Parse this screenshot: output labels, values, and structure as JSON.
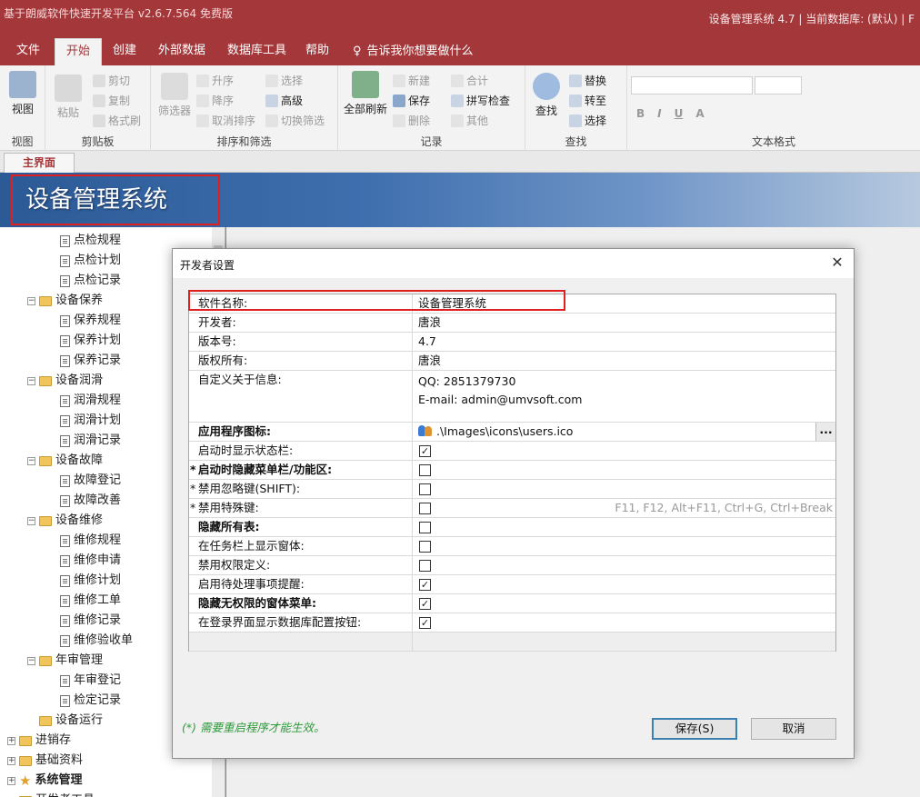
{
  "titlebar": {
    "app_caption": "基于朗威软件快速开发平台 v2.6.7.564 免费版",
    "window_info": "设备管理系统 4.7 | 当前数据库: (默认) | F"
  },
  "menu": {
    "tabs": [
      "文件",
      "开始",
      "创建",
      "外部数据",
      "数据库工具",
      "帮助"
    ],
    "active": "开始",
    "tell_me": "告诉我你想要做什么"
  },
  "ribbon": {
    "view": {
      "button": "视图",
      "label": "视图"
    },
    "clipboard": {
      "paste": "粘贴",
      "cut": "剪切",
      "copy": "复制",
      "format_painter": "格式刷",
      "label": "剪贴板"
    },
    "sort_filter": {
      "filter": "筛选器",
      "asc": "升序",
      "desc": "降序",
      "remove_sort": "取消排序",
      "select": "选择",
      "advanced": "高级",
      "toggle": "切换筛选",
      "label": "排序和筛选"
    },
    "records": {
      "refresh_all": "全部刷新",
      "new": "新建",
      "save": "保存",
      "delete": "删除",
      "totals": "合计",
      "spelling": "拼写检查",
      "more": "其他",
      "label": "记录"
    },
    "find": {
      "find": "查找",
      "replace": "替换",
      "goto": "转至",
      "select": "选择",
      "label": "查找"
    },
    "text_format": {
      "label": "文本格式",
      "bold": "B",
      "italic": "I",
      "underline": "U",
      "font_color": "A"
    }
  },
  "doc_tab": "主界面",
  "banner_title": "设备管理系统",
  "tree": [
    {
      "label": "点检规程",
      "type": "doc",
      "level": 2
    },
    {
      "label": "点检计划",
      "type": "doc",
      "level": 2
    },
    {
      "label": "点检记录",
      "type": "doc",
      "level": 2
    },
    {
      "label": "设备保养",
      "type": "folder",
      "level": 1
    },
    {
      "label": "保养规程",
      "type": "doc",
      "level": 2
    },
    {
      "label": "保养计划",
      "type": "doc",
      "level": 2
    },
    {
      "label": "保养记录",
      "type": "doc",
      "level": 2
    },
    {
      "label": "设备润滑",
      "type": "folder",
      "level": 1
    },
    {
      "label": "润滑规程",
      "type": "doc",
      "level": 2
    },
    {
      "label": "润滑计划",
      "type": "doc",
      "level": 2
    },
    {
      "label": "润滑记录",
      "type": "doc",
      "level": 2
    },
    {
      "label": "设备故障",
      "type": "folder",
      "level": 1
    },
    {
      "label": "故障登记",
      "type": "doc",
      "level": 2
    },
    {
      "label": "故障改善",
      "type": "doc",
      "level": 2
    },
    {
      "label": "设备维修",
      "type": "folder",
      "level": 1
    },
    {
      "label": "维修规程",
      "type": "doc",
      "level": 2
    },
    {
      "label": "维修申请",
      "type": "doc",
      "level": 2
    },
    {
      "label": "维修计划",
      "type": "doc",
      "level": 2
    },
    {
      "label": "维修工单",
      "type": "doc",
      "level": 2
    },
    {
      "label": "维修记录",
      "type": "doc",
      "level": 2
    },
    {
      "label": "维修验收单",
      "type": "doc",
      "level": 2
    },
    {
      "label": "年审管理",
      "type": "folder",
      "level": 1
    },
    {
      "label": "年审登记",
      "type": "doc",
      "level": 2
    },
    {
      "label": "检定记录",
      "type": "doc",
      "level": 2
    },
    {
      "label": "设备运行",
      "type": "folder",
      "level": 1
    },
    {
      "label": "进销存",
      "type": "root",
      "level": 0
    },
    {
      "label": "基础资料",
      "type": "root",
      "level": 0
    },
    {
      "label": "系统管理",
      "type": "root-star",
      "level": 0
    },
    {
      "label": "开发者工具",
      "type": "root",
      "level": 0
    }
  ],
  "dialog": {
    "title": "开发者设置",
    "close": "✕",
    "rows": [
      {
        "key": "软件名称:",
        "value": "设备管理系统",
        "bold": false
      },
      {
        "key": "开发者:",
        "value": "唐浪",
        "bold": false
      },
      {
        "key": "版本号:",
        "value": "4.7",
        "bold": false
      },
      {
        "key": "版权所有:",
        "value": "唐浪",
        "bold": false
      },
      {
        "key": "自定义关于信息:",
        "value_lines": [
          "QQ:  2851379730",
          "E-mail:  admin@umvsoft.com"
        ],
        "bold": false
      },
      {
        "key": "应用程序图标:",
        "value": ".\\Images\\icons\\users.ico",
        "bold": true,
        "browse": "..."
      },
      {
        "key": "启动时显示状态栏:",
        "checked": true,
        "bold": false
      },
      {
        "key": "启动时隐藏菜单栏/功能区:",
        "checked": false,
        "bold": true,
        "mark": "*"
      },
      {
        "key": "禁用忽略键(SHIFT):",
        "checked": false,
        "bold": false,
        "mark": "*"
      },
      {
        "key": "禁用特殊键:",
        "checked": false,
        "bold": false,
        "mark": "*",
        "hint": "F11, F12, Alt+F11, Ctrl+G, Ctrl+Break"
      },
      {
        "key": "隐藏所有表:",
        "checked": false,
        "bold": true
      },
      {
        "key": "在任务栏上显示窗体:",
        "checked": false,
        "bold": false
      },
      {
        "key": "禁用权限定义:",
        "checked": false,
        "bold": false
      },
      {
        "key": "启用待处理事项提醒:",
        "checked": true,
        "bold": false
      },
      {
        "key": "隐藏无权限的窗体菜单:",
        "checked": true,
        "bold": true
      },
      {
        "key": "在登录界面显示数据库配置按钮:",
        "checked": true,
        "bold": false
      }
    ],
    "note": "(*) 需要重启程序才能生效。",
    "save_button": "保存(S)",
    "cancel_button": "取消"
  }
}
